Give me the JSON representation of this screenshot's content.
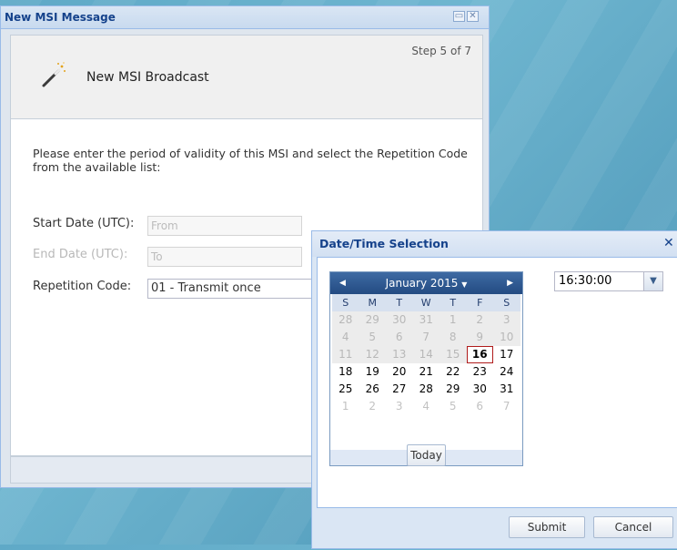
{
  "window": {
    "title": "New MSI Message",
    "step": "Step 5 of 7",
    "heading": "New MSI Broadcast",
    "instructions": "Please enter the period of validity of this MSI and select the Repetition Code from the available list:",
    "fields": {
      "start_label": "Start Date (UTC):",
      "start_placeholder": "From",
      "end_label": "End Date (UTC):",
      "end_placeholder": "To",
      "repetition_label": "Repetition Code:",
      "repetition_value": "01 - Transmit once"
    }
  },
  "dialog": {
    "title": "Date/Time Selection",
    "close_glyph": "✕",
    "time_value": "16:30:00",
    "submit_label": "Submit",
    "cancel_label": "Cancel",
    "calendar": {
      "month_label": "January 2015",
      "weekdays": [
        "S",
        "M",
        "T",
        "W",
        "T",
        "F",
        "S"
      ],
      "weeks": [
        [
          {
            "d": "28",
            "s": "other-disabled"
          },
          {
            "d": "29",
            "s": "other-disabled"
          },
          {
            "d": "30",
            "s": "other-disabled"
          },
          {
            "d": "31",
            "s": "other-disabled"
          },
          {
            "d": "1",
            "s": "disabled"
          },
          {
            "d": "2",
            "s": "disabled"
          },
          {
            "d": "3",
            "s": "disabled"
          }
        ],
        [
          {
            "d": "4",
            "s": "disabled"
          },
          {
            "d": "5",
            "s": "disabled"
          },
          {
            "d": "6",
            "s": "disabled"
          },
          {
            "d": "7",
            "s": "disabled"
          },
          {
            "d": "8",
            "s": "disabled"
          },
          {
            "d": "9",
            "s": "disabled"
          },
          {
            "d": "10",
            "s": "disabled"
          }
        ],
        [
          {
            "d": "11",
            "s": "disabled"
          },
          {
            "d": "12",
            "s": "disabled"
          },
          {
            "d": "13",
            "s": "disabled"
          },
          {
            "d": "14",
            "s": "disabled"
          },
          {
            "d": "15",
            "s": "disabled"
          },
          {
            "d": "16",
            "s": "today"
          },
          {
            "d": "17",
            "s": "normal"
          }
        ],
        [
          {
            "d": "18",
            "s": "normal"
          },
          {
            "d": "19",
            "s": "normal"
          },
          {
            "d": "20",
            "s": "normal"
          },
          {
            "d": "21",
            "s": "normal"
          },
          {
            "d": "22",
            "s": "normal"
          },
          {
            "d": "23",
            "s": "normal"
          },
          {
            "d": "24",
            "s": "normal"
          }
        ],
        [
          {
            "d": "25",
            "s": "normal"
          },
          {
            "d": "26",
            "s": "normal"
          },
          {
            "d": "27",
            "s": "normal"
          },
          {
            "d": "28",
            "s": "normal"
          },
          {
            "d": "29",
            "s": "normal"
          },
          {
            "d": "30",
            "s": "normal"
          },
          {
            "d": "31",
            "s": "normal"
          }
        ],
        [
          {
            "d": "1",
            "s": "other"
          },
          {
            "d": "2",
            "s": "other"
          },
          {
            "d": "3",
            "s": "other"
          },
          {
            "d": "4",
            "s": "other"
          },
          {
            "d": "5",
            "s": "other"
          },
          {
            "d": "6",
            "s": "other"
          },
          {
            "d": "7",
            "s": "other"
          }
        ]
      ],
      "today_label": "Today"
    }
  },
  "colors": {
    "title_text": "#15428b",
    "calendar_header": "#234b82",
    "today_border": "#b01b1b"
  }
}
